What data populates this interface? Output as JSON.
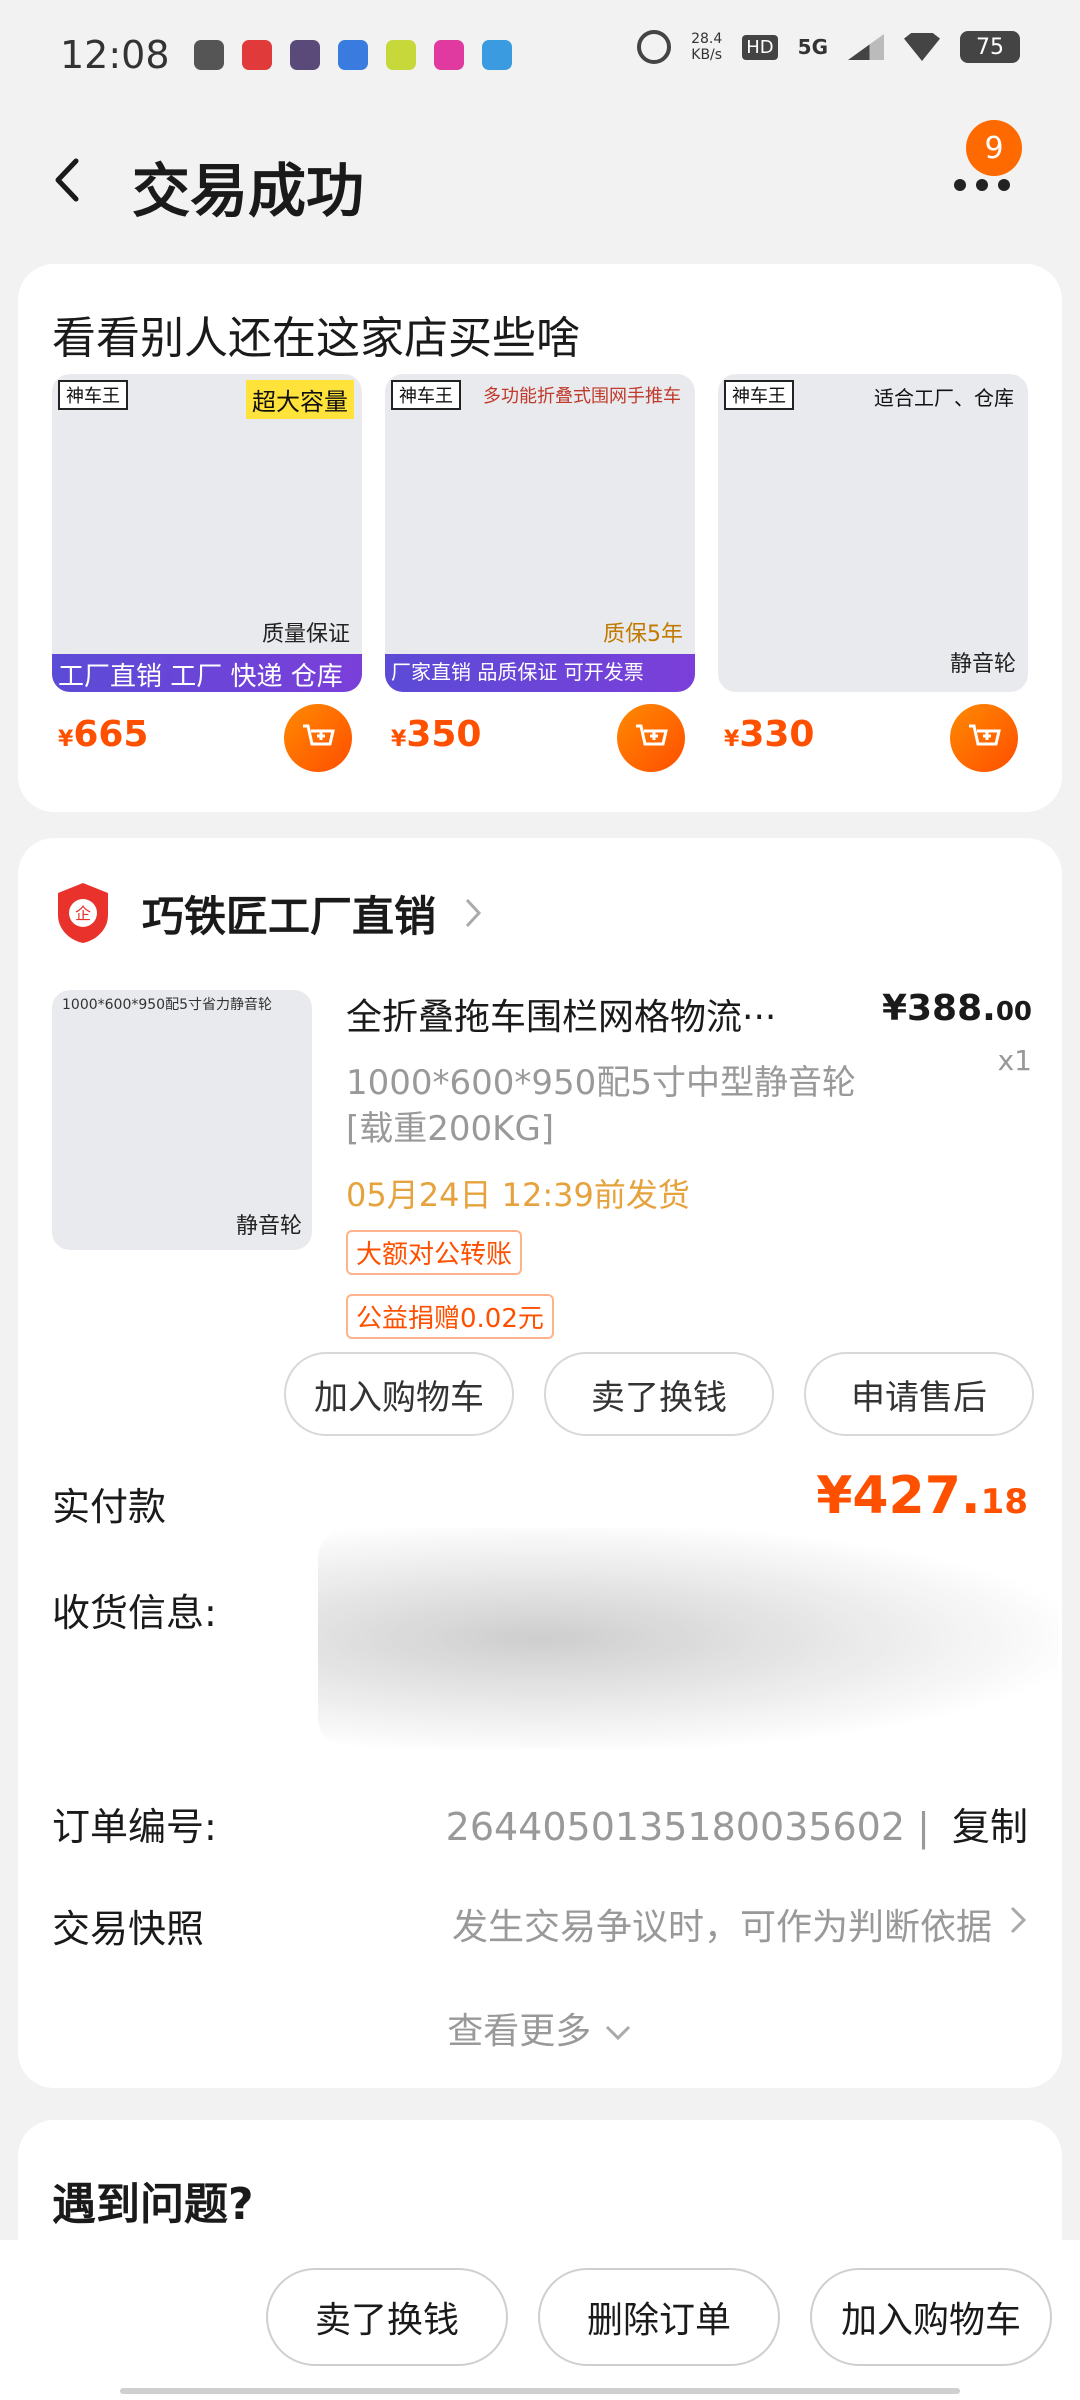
{
  "status_bar": {
    "time": "12:08",
    "network_speed": "28.4\nKB/s",
    "network": "5G",
    "battery": "75"
  },
  "header": {
    "title": "交易成功",
    "badge_count": "9"
  },
  "recommend": {
    "title": "看看别人还在这家店买些啥",
    "products": [
      {
        "brand": "神车王",
        "tag": "超大容量",
        "bottom": "工厂直销  工厂 快递 仓库",
        "corner": "质量保证",
        "currency": "¥",
        "price": "665"
      },
      {
        "brand": "神车王",
        "tag": "多功能折叠式围网手推车",
        "bottom": "厂家直销 品质保证 可开发票",
        "corner": "质保5年",
        "currency": "¥",
        "price": "350"
      },
      {
        "brand": "神车王",
        "tag": "适合工厂、仓库",
        "bottom": "",
        "corner": "静音轮",
        "currency": "¥",
        "price": "330"
      }
    ]
  },
  "order": {
    "shop_name": "巧铁匠工厂直销",
    "image_top_text": "1000*600*950配5寸省力静音轮",
    "image_corner": "静音轮",
    "title": "全折叠拖车围栏网格物流···",
    "price_main": "¥388.",
    "price_cents": "00",
    "quantity": "x1",
    "spec": "1000*600*950配5寸中型静音轮[载重200KG]",
    "ship_time": "05月24日 12:39前发货",
    "tag1": "大额对公转账",
    "tag2": "公益捐赠0.02元",
    "buttons": [
      "加入购物车",
      "卖了换钱",
      "申请售后"
    ],
    "paid_label": "实付款",
    "paid_main": "¥427.",
    "paid_cents": "18",
    "address_label": "收货信息:",
    "order_no_label": "订单编号:",
    "order_no": "2644050135180035602",
    "copy_label": "复制",
    "snapshot_label": "交易快照",
    "snapshot_hint": "发生交易争议时，可作为判断依据",
    "more_label": "查看更多"
  },
  "problem": {
    "title": "遇到问题?"
  },
  "bottom_bar": {
    "buttons": [
      "卖了换钱",
      "删除订单",
      "加入购物车"
    ]
  },
  "colors": {
    "accent": "#ff5000",
    "ship_time": "#e6a23c",
    "badge": "#ff6a00"
  }
}
